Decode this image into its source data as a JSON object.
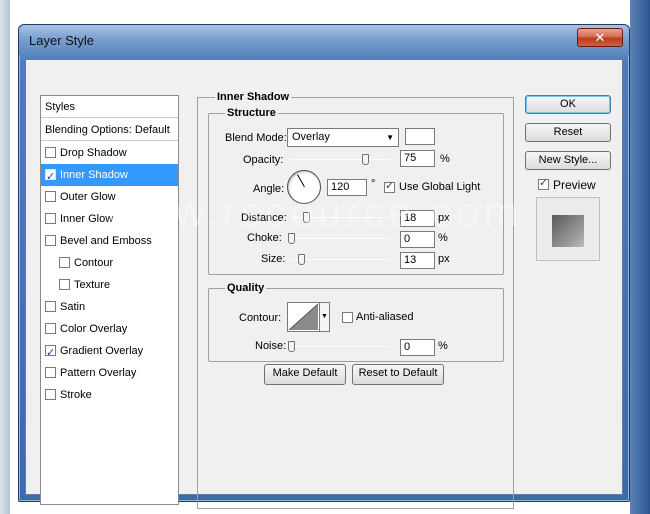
{
  "window": {
    "title": "Layer Style",
    "close_glyph": "✕"
  },
  "styles_list": {
    "header": "Styles",
    "blending": "Blending Options: Default",
    "items": [
      {
        "label": "Drop Shadow",
        "checked": false,
        "selected": false,
        "indent": false
      },
      {
        "label": "Inner Shadow",
        "checked": true,
        "selected": true,
        "indent": false
      },
      {
        "label": "Outer Glow",
        "checked": false,
        "selected": false,
        "indent": false
      },
      {
        "label": "Inner Glow",
        "checked": false,
        "selected": false,
        "indent": false
      },
      {
        "label": "Bevel and Emboss",
        "checked": false,
        "selected": false,
        "indent": false
      },
      {
        "label": "Contour",
        "checked": false,
        "selected": false,
        "indent": true
      },
      {
        "label": "Texture",
        "checked": false,
        "selected": false,
        "indent": true
      },
      {
        "label": "Satin",
        "checked": false,
        "selected": false,
        "indent": false
      },
      {
        "label": "Color Overlay",
        "checked": false,
        "selected": false,
        "indent": false
      },
      {
        "label": "Gradient Overlay",
        "checked": true,
        "selected": false,
        "indent": false
      },
      {
        "label": "Pattern Overlay",
        "checked": false,
        "selected": false,
        "indent": false
      },
      {
        "label": "Stroke",
        "checked": false,
        "selected": false,
        "indent": false
      }
    ]
  },
  "inner_shadow": {
    "title": "Inner Shadow",
    "structure": {
      "title": "Structure",
      "blend_mode_label": "Blend Mode:",
      "blend_mode_value": "Overlay",
      "swatch_color": "#ffffff",
      "opacity_label": "Opacity:",
      "opacity_value": "75",
      "opacity_unit": "%",
      "opacity_level": 75,
      "angle_label": "Angle:",
      "angle_value": "120",
      "angle_unit": "°",
      "use_global_light_label": "Use Global Light",
      "use_global_light": true,
      "distance_label": "Distance:",
      "distance_value": "18",
      "distance_unit": "px",
      "distance_level": 18,
      "choke_label": "Choke:",
      "choke_value": "0",
      "choke_unit": "%",
      "choke_level": 0,
      "size_label": "Size:",
      "size_value": "13",
      "size_unit": "px",
      "size_level": 13
    },
    "quality": {
      "title": "Quality",
      "contour_label": "Contour:",
      "anti_aliased_label": "Anti-aliased",
      "anti_aliased": false,
      "noise_label": "Noise:",
      "noise_value": "0",
      "noise_unit": "%",
      "noise_level": 0
    },
    "make_default": "Make Default",
    "reset_default": "Reset to Default"
  },
  "buttons": {
    "ok": "OK",
    "reset": "Reset",
    "new_style": "New Style...",
    "preview_label": "Preview",
    "preview_checked": true
  },
  "watermark": "www.rscource.com",
  "colors": {
    "selection": "#3399ff",
    "title_blue": "#5a86bf",
    "close_red": "#c8492a"
  }
}
